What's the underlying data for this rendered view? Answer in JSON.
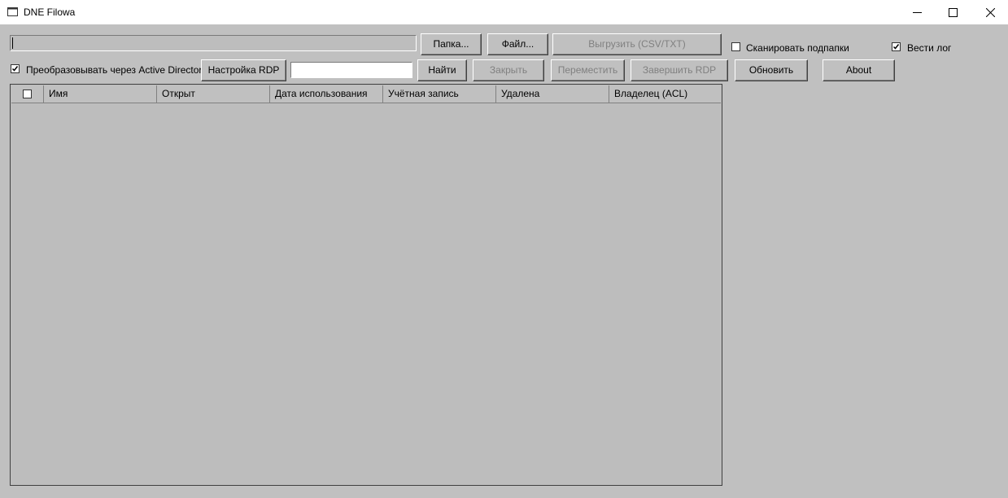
{
  "window": {
    "title": "DNE Filowa"
  },
  "toolbar": {
    "path_value": "",
    "folder_button": "Папка...",
    "file_button": "Файл...",
    "export_button": "Выгрузить (CSV/TXT)",
    "scan_subfolders_label": "Сканировать подпапки",
    "scan_subfolders_checked": false,
    "log_label": "Вести лог",
    "log_checked": true,
    "ad_convert_label": "Преобразовывать через Active Directory",
    "ad_convert_checked": true,
    "rdp_settings_button": "Настройка RDP",
    "search_value": "",
    "find_button": "Найти",
    "close_button": "Закрыть",
    "move_button": "Переместить",
    "end_rdp_button": "Завершить RDP",
    "refresh_button": "Обновить",
    "about_button": "About"
  },
  "table": {
    "columns": [
      "Имя",
      "Открыт",
      "Дата использования",
      "Учётная запись",
      "Удалена",
      "Владелец (ACL)"
    ],
    "rows": []
  }
}
